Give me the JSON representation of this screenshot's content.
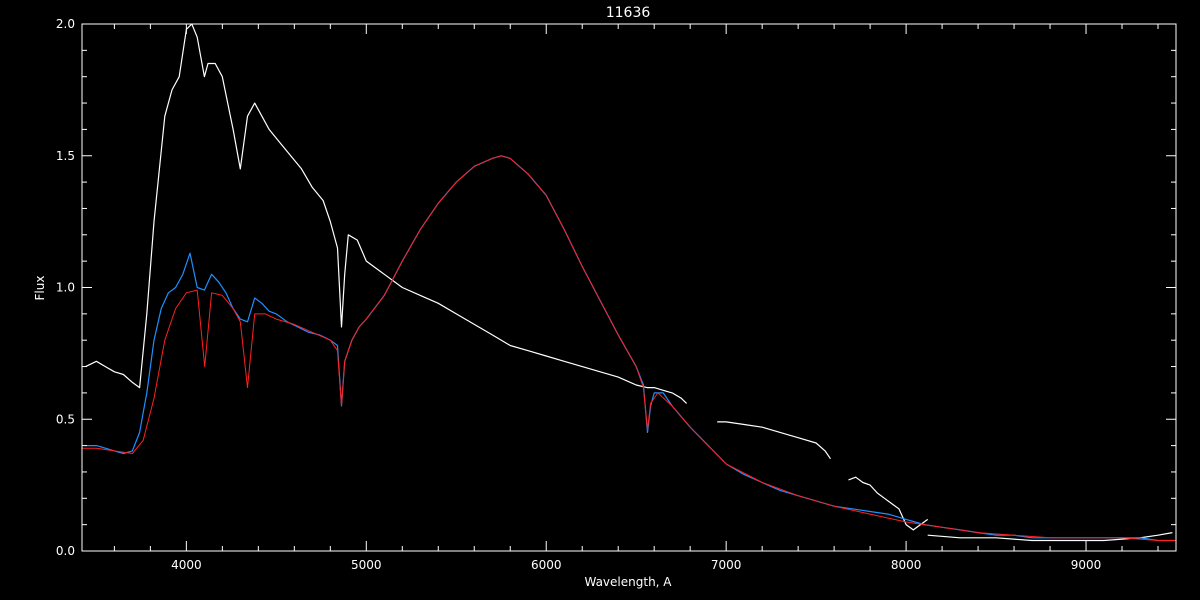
{
  "chart_data": {
    "type": "line",
    "title": "11636",
    "xlabel": "Wavelength, A",
    "ylabel": "Flux",
    "xlim": [
      3420,
      9500
    ],
    "ylim": [
      0,
      2.0
    ],
    "xticks": [
      4000,
      5000,
      6000,
      7000,
      8000,
      9000
    ],
    "yticks": [
      0.0,
      0.5,
      1.0,
      1.5,
      2.0
    ],
    "xtick_labels": [
      "4000",
      "5000",
      "6000",
      "7000",
      "8000",
      "9000"
    ],
    "ytick_labels": [
      "0.0",
      "0.5",
      "1.0",
      "1.5",
      "2.0"
    ],
    "grid": false,
    "colors": {
      "background": "#000000",
      "axes": "#ffffff",
      "observed": "#ffffff",
      "fit": "#1e90ff",
      "model": "#ff2020"
    },
    "series": [
      {
        "color": "#ffffff",
        "segments": [
          {
            "x": [
              3440,
              3500,
              3550,
              3600,
              3650,
              3700,
              3740,
              3780,
              3820,
              3850,
              3880,
              3920,
              3960,
              4000,
              4030,
              4060,
              4100,
              4120,
              4160,
              4200,
              4260,
              4300,
              4340,
              4380,
              4420,
              4460,
              4520,
              4580,
              4640,
              4700,
              4760,
              4800,
              4840,
              4862,
              4880,
              4900,
              4950,
              5000,
              5100,
              5200,
              5300,
              5400,
              5500,
              5600,
              5700,
              5800,
              5900,
              6000,
              6100,
              6200,
              6300,
              6400,
              6500,
              6560,
              6600,
              6650,
              6700,
              6750,
              6780
            ],
            "y": [
              0.7,
              0.72,
              0.7,
              0.68,
              0.67,
              0.64,
              0.62,
              0.9,
              1.25,
              1.45,
              1.65,
              1.75,
              1.8,
              1.98,
              2.0,
              1.95,
              1.8,
              1.85,
              1.85,
              1.8,
              1.6,
              1.45,
              1.65,
              1.7,
              1.65,
              1.6,
              1.55,
              1.5,
              1.45,
              1.38,
              1.33,
              1.25,
              1.15,
              0.85,
              1.05,
              1.2,
              1.18,
              1.1,
              1.05,
              1.0,
              0.97,
              0.94,
              0.9,
              0.86,
              0.82,
              0.78,
              0.76,
              0.74,
              0.72,
              0.7,
              0.68,
              0.66,
              0.63,
              0.62,
              0.62,
              0.61,
              0.6,
              0.58,
              0.56
            ]
          },
          {
            "x": [
              6950,
              7000,
              7100,
              7200,
              7300,
              7400,
              7500,
              7550,
              7580
            ],
            "y": [
              0.49,
              0.49,
              0.48,
              0.47,
              0.45,
              0.43,
              0.41,
              0.38,
              0.35
            ]
          },
          {
            "x": [
              7680,
              7720,
              7760,
              7800,
              7840,
              7880,
              7920,
              7960,
              8000,
              8040,
              8080,
              8120
            ],
            "y": [
              0.27,
              0.28,
              0.26,
              0.25,
              0.22,
              0.2,
              0.18,
              0.16,
              0.1,
              0.08,
              0.1,
              0.12
            ]
          },
          {
            "x": [
              8120,
              8300,
              8500,
              8700,
              8900,
              9100,
              9300,
              9400,
              9480
            ],
            "y": [
              0.06,
              0.05,
              0.05,
              0.04,
              0.04,
              0.04,
              0.05,
              0.06,
              0.07
            ]
          }
        ]
      },
      {
        "color": "#1e90ff",
        "x": [
          3440,
          3500,
          3550,
          3600,
          3650,
          3700,
          3740,
          3780,
          3820,
          3860,
          3900,
          3940,
          3980,
          4020,
          4060,
          4100,
          4140,
          4180,
          4220,
          4260,
          4300,
          4340,
          4380,
          4420,
          4460,
          4500,
          4560,
          4620,
          4680,
          4740,
          4800,
          4840,
          4862,
          4880,
          4920,
          4960,
          5000,
          5100,
          5200,
          5300,
          5400,
          5500,
          5600,
          5700,
          5750,
          5800,
          5900,
          6000,
          6100,
          6200,
          6300,
          6400,
          6500,
          6540,
          6563,
          6580,
          6600,
          6650,
          6700,
          6800,
          6900,
          7000,
          7100,
          7200,
          7300,
          7400,
          7500,
          7600,
          7700,
          7800,
          7900,
          7950,
          8000,
          8050,
          8100,
          8200,
          8300,
          8400,
          8500,
          8600,
          8700,
          8800,
          8900,
          9000,
          9100,
          9200,
          9300,
          9400,
          9480
        ],
        "y": [
          0.4,
          0.4,
          0.39,
          0.38,
          0.37,
          0.38,
          0.45,
          0.6,
          0.8,
          0.92,
          0.98,
          1.0,
          1.05,
          1.13,
          1.0,
          0.99,
          1.05,
          1.02,
          0.98,
          0.92,
          0.88,
          0.87,
          0.96,
          0.94,
          0.91,
          0.9,
          0.87,
          0.85,
          0.83,
          0.82,
          0.8,
          0.78,
          0.55,
          0.72,
          0.8,
          0.85,
          0.88,
          0.97,
          1.1,
          1.22,
          1.32,
          1.4,
          1.46,
          1.49,
          1.5,
          1.49,
          1.43,
          1.35,
          1.22,
          1.08,
          0.95,
          0.82,
          0.7,
          0.63,
          0.45,
          0.55,
          0.6,
          0.6,
          0.55,
          0.47,
          0.4,
          0.33,
          0.29,
          0.26,
          0.23,
          0.21,
          0.19,
          0.17,
          0.16,
          0.15,
          0.14,
          0.13,
          0.12,
          0.11,
          0.1,
          0.09,
          0.08,
          0.07,
          0.06,
          0.06,
          0.05,
          0.05,
          0.05,
          0.05,
          0.05,
          0.05,
          0.05,
          0.04,
          0.04
        ]
      },
      {
        "color": "#ff2020",
        "x": [
          3420,
          3500,
          3600,
          3700,
          3760,
          3820,
          3880,
          3940,
          4000,
          4060,
          4102,
          4140,
          4200,
          4260,
          4300,
          4340,
          4380,
          4440,
          4500,
          4600,
          4700,
          4800,
          4840,
          4862,
          4880,
          4920,
          4960,
          5000,
          5100,
          5200,
          5300,
          5400,
          5500,
          5600,
          5700,
          5750,
          5800,
          5900,
          6000,
          6100,
          6200,
          6300,
          6400,
          6500,
          6540,
          6563,
          6580,
          6620,
          6700,
          6800,
          6900,
          7000,
          7200,
          7400,
          7600,
          7800,
          8000,
          8200,
          8400,
          8600,
          8800,
          9000,
          9200,
          9400,
          9500
        ],
        "y": [
          0.39,
          0.39,
          0.38,
          0.37,
          0.42,
          0.58,
          0.8,
          0.92,
          0.98,
          0.99,
          0.7,
          0.98,
          0.97,
          0.92,
          0.87,
          0.62,
          0.9,
          0.9,
          0.88,
          0.86,
          0.83,
          0.8,
          0.76,
          0.55,
          0.72,
          0.8,
          0.85,
          0.88,
          0.97,
          1.1,
          1.22,
          1.32,
          1.4,
          1.46,
          1.49,
          1.5,
          1.49,
          1.43,
          1.35,
          1.22,
          1.08,
          0.95,
          0.82,
          0.7,
          0.62,
          0.46,
          0.56,
          0.6,
          0.55,
          0.47,
          0.4,
          0.33,
          0.26,
          0.21,
          0.17,
          0.14,
          0.11,
          0.09,
          0.07,
          0.06,
          0.05,
          0.05,
          0.05,
          0.04,
          0.04
        ]
      }
    ]
  }
}
